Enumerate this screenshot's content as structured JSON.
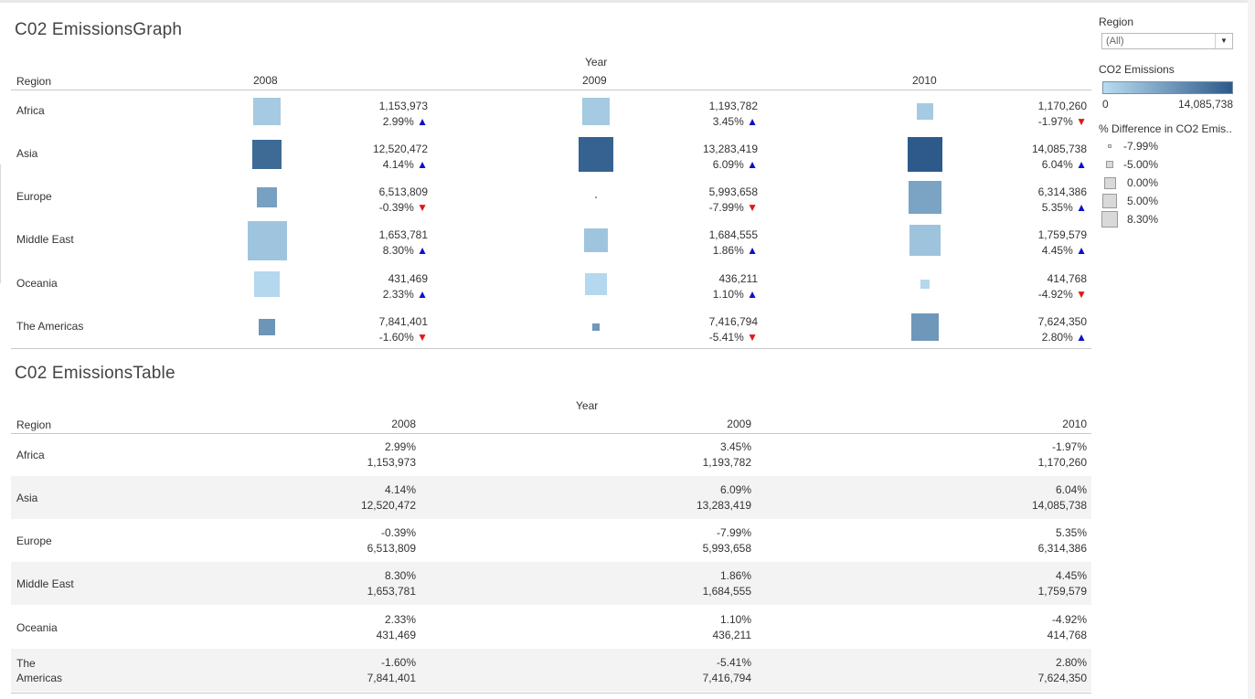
{
  "graph": {
    "title": "C02 EmissionsGraph",
    "year_label": "Year",
    "region_label": "Region",
    "years": [
      "2008",
      "2009",
      "2010"
    ],
    "rows": [
      {
        "region": "Africa",
        "cells": [
          {
            "value": "1,153,973",
            "pct": "2.99%",
            "dir": "up",
            "level": 0.14,
            "diff": 0.0299
          },
          {
            "value": "1,193,782",
            "pct": "3.45%",
            "dir": "up",
            "level": 0.14,
            "diff": 0.0345
          },
          {
            "value": "1,170,260",
            "pct": "-1.97%",
            "dir": "down",
            "level": 0.14,
            "diff": -0.0197
          }
        ]
      },
      {
        "region": "Asia",
        "cells": [
          {
            "value": "12,520,472",
            "pct": "4.14%",
            "dir": "up",
            "level": 0.88,
            "diff": 0.0414
          },
          {
            "value": "13,283,419",
            "pct": "6.09%",
            "dir": "up",
            "level": 0.94,
            "diff": 0.0609
          },
          {
            "value": "14,085,738",
            "pct": "6.04%",
            "dir": "up",
            "level": 1.0,
            "diff": 0.0604
          }
        ]
      },
      {
        "region": "Europe",
        "cells": [
          {
            "value": "6,513,809",
            "pct": "-0.39%",
            "dir": "down",
            "level": 0.46,
            "diff": -0.0039
          },
          {
            "value": "5,993,658",
            "pct": "-7.99%",
            "dir": "down",
            "level": 0.42,
            "diff": -0.0799
          },
          {
            "value": "6,314,386",
            "pct": "5.35%",
            "dir": "up",
            "level": 0.44,
            "diff": 0.0535
          }
        ]
      },
      {
        "region": "Middle East",
        "cells": [
          {
            "value": "1,653,781",
            "pct": "8.30%",
            "dir": "up",
            "level": 0.18,
            "diff": 0.083
          },
          {
            "value": "1,684,555",
            "pct": "1.86%",
            "dir": "up",
            "level": 0.18,
            "diff": 0.0186
          },
          {
            "value": "1,759,579",
            "pct": "4.45%",
            "dir": "up",
            "level": 0.19,
            "diff": 0.0445
          }
        ]
      },
      {
        "region": "Oceania",
        "cells": [
          {
            "value": "431,469",
            "pct": "2.33%",
            "dir": "up",
            "level": 0.03,
            "diff": 0.0233
          },
          {
            "value": "436,211",
            "pct": "1.10%",
            "dir": "up",
            "level": 0.03,
            "diff": 0.011
          },
          {
            "value": "414,768",
            "pct": "-4.92%",
            "dir": "down",
            "level": 0.03,
            "diff": -0.0492
          }
        ]
      },
      {
        "region": "The Americas",
        "cells": [
          {
            "value": "7,841,401",
            "pct": "-1.60%",
            "dir": "down",
            "level": 0.55,
            "diff": -0.016
          },
          {
            "value": "7,416,794",
            "pct": "-5.41%",
            "dir": "down",
            "level": 0.52,
            "diff": -0.0541
          },
          {
            "value": "7,624,350",
            "pct": "2.80%",
            "dir": "up",
            "level": 0.53,
            "diff": 0.028
          }
        ]
      }
    ]
  },
  "table": {
    "title": "C02 EmissionsTable",
    "year_label": "Year",
    "region_label": "Region",
    "years": [
      "2008",
      "2009",
      "2010"
    ],
    "rows": [
      {
        "region": "Africa",
        "cells": [
          {
            "pct": "2.99%",
            "value": "1,153,973"
          },
          {
            "pct": "3.45%",
            "value": "1,193,782"
          },
          {
            "pct": "-1.97%",
            "value": "1,170,260"
          }
        ]
      },
      {
        "region": "Asia",
        "cells": [
          {
            "pct": "4.14%",
            "value": "12,520,472"
          },
          {
            "pct": "6.09%",
            "value": "13,283,419"
          },
          {
            "pct": "6.04%",
            "value": "14,085,738"
          }
        ]
      },
      {
        "region": "Europe",
        "cells": [
          {
            "pct": "-0.39%",
            "value": "6,513,809"
          },
          {
            "pct": "-7.99%",
            "value": "5,993,658"
          },
          {
            "pct": "5.35%",
            "value": "6,314,386"
          }
        ]
      },
      {
        "region": "Middle East",
        "cells": [
          {
            "pct": "8.30%",
            "value": "1,653,781"
          },
          {
            "pct": "1.86%",
            "value": "1,684,555"
          },
          {
            "pct": "4.45%",
            "value": "1,759,579"
          }
        ]
      },
      {
        "region": "Oceania",
        "cells": [
          {
            "pct": "2.33%",
            "value": "431,469"
          },
          {
            "pct": "1.10%",
            "value": "436,211"
          },
          {
            "pct": "-4.92%",
            "value": "414,768"
          }
        ]
      },
      {
        "region": "The\nAmericas",
        "cells": [
          {
            "pct": "-1.60%",
            "value": "7,841,401"
          },
          {
            "pct": "-5.41%",
            "value": "7,416,794"
          },
          {
            "pct": "2.80%",
            "value": "7,624,350"
          }
        ]
      }
    ]
  },
  "legend": {
    "filter_title": "Region",
    "filter_value": "(All)",
    "color_title": "CO2 Emissions",
    "color_min": "0",
    "color_max": "14,085,738",
    "size_title": "% Difference in CO2 Emis..",
    "size_items": [
      "-7.99%",
      "-5.00%",
      "0.00%",
      "5.00%",
      "8.30%"
    ]
  },
  "colors": {
    "light": "#b8dcf0",
    "dark": "#2d5a8a",
    "up_arrow": "#0a12c8",
    "down_arrow": "#e01818",
    "band": "#f3f3f3"
  }
}
